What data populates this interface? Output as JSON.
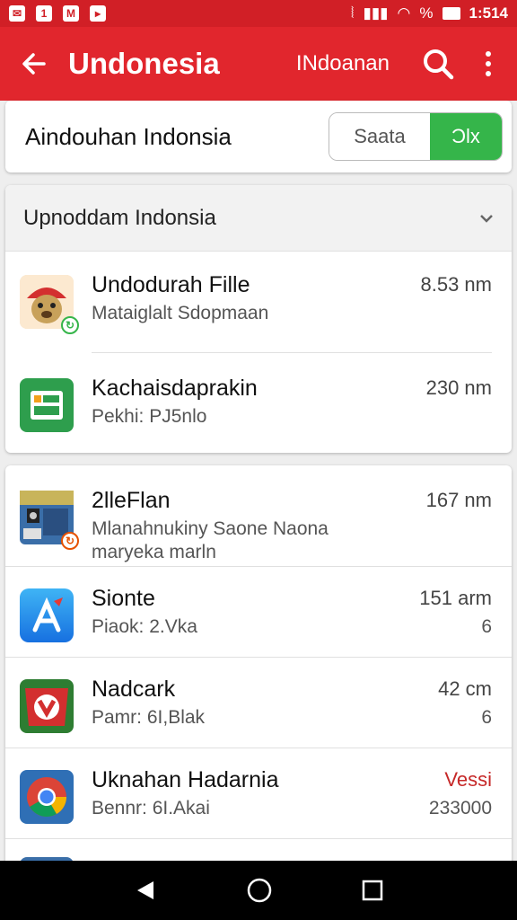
{
  "status_bar": {
    "left_icons": [
      "notification-icon",
      "mail-icon",
      "download-icon"
    ],
    "right_icons": [
      "vibrate-icon",
      "signal-icon",
      "wifi-icon"
    ],
    "battery_pct": "%",
    "time": "1:514"
  },
  "app_bar": {
    "title": "Undonesia",
    "subtitle": "INdoanan"
  },
  "filter_card": {
    "title": "Aindouhan Indonsia",
    "toggle_left": "Saata",
    "toggle_right": "Ͻlx"
  },
  "section": {
    "title": "Upnoddam Indonsia"
  },
  "rows": [
    {
      "title": "Undodurah Fille",
      "subtitle": "Mataiglalt Sdopmaan",
      "size": "8.53 nm",
      "extra": ""
    },
    {
      "title": "Kachaisdaprakin",
      "subtitle": "Pekhi: PJ5nlo",
      "size": "230 nm",
      "extra": ""
    },
    {
      "title": "2lleFlan",
      "subtitle": "Mlanahnukiny Saone Naona",
      "subtitle2": "maryeka marln",
      "size": "167 nm",
      "extra": ""
    },
    {
      "title": "Sionte",
      "subtitle": "Piaok: 2.Vka",
      "size": "151 arm",
      "extra": "6"
    },
    {
      "title": "Nadcark",
      "subtitle": "Pamr: 6I,Blak",
      "size": "42 cm",
      "extra": "6"
    },
    {
      "title": "Uknahan Hadarnia",
      "subtitle": "Bennr: 6I.Akai",
      "size": "Vessi",
      "extra": "233000"
    }
  ],
  "colors": {
    "status_bar": "#d11f26",
    "app_bar": "#e1262d",
    "toggle_active": "#35b54a",
    "accent_red_text": "#c62828"
  }
}
